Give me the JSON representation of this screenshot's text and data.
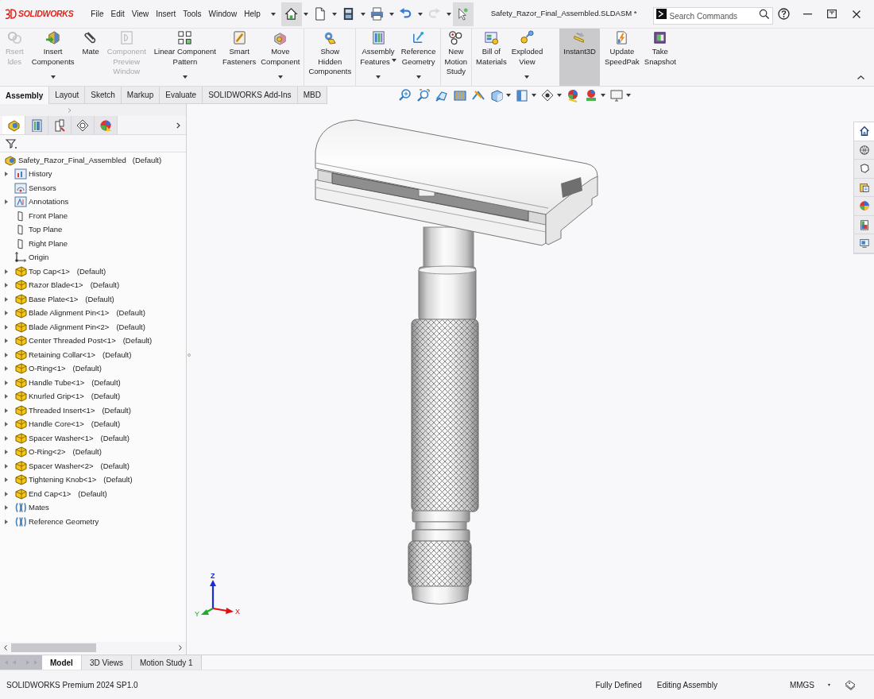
{
  "title_bar": {
    "logo": "SOLIDWORKS",
    "menu": [
      "File",
      "Edit",
      "View",
      "Insert",
      "Tools",
      "Window",
      "Help"
    ],
    "quick_access": [
      {
        "selected": true,
        "disabled": false,
        "dropdown": true
      },
      {
        "selected": false,
        "disabled": false,
        "dropdown": true
      },
      {
        "selected": false,
        "disabled": false,
        "dropdown": true
      },
      {
        "selected": false,
        "disabled": false,
        "dropdown": true
      },
      {
        "selected": false,
        "disabled": false,
        "dropdown": true
      },
      {
        "selected": false,
        "disabled": true,
        "dropdown": true
      },
      {
        "selected": true,
        "disabled": false,
        "dropdown": false
      }
    ],
    "document_title": "Safety_Razor_Final_Assembled.SLDASM *",
    "search": {
      "placeholder": "Search Commands"
    }
  },
  "ribbon": {
    "groups": [
      {
        "items": [
          {
            "lines": [
              "Rsert",
              "ldes"
            ],
            "disabled": true,
            "selected": false,
            "dropdown": false,
            "menu_caret": false
          },
          {
            "lines": [
              "Insert",
              "Components"
            ],
            "disabled": false,
            "selected": false,
            "dropdown": true,
            "menu_caret": false
          },
          {
            "lines": [
              "Mate"
            ],
            "disabled": false,
            "selected": false,
            "dropdown": false,
            "menu_caret": false
          },
          {
            "lines": [
              "Component",
              "Preview",
              "Window"
            ],
            "disabled": true,
            "selected": false,
            "dropdown": false,
            "menu_caret": false
          },
          {
            "lines": [
              "Linear Component",
              "Pattern"
            ],
            "disabled": false,
            "selected": false,
            "dropdown": true,
            "menu_caret": false
          },
          {
            "lines": [
              "Smart",
              "Fasteners"
            ],
            "disabled": false,
            "selected": false,
            "dropdown": false,
            "menu_caret": false
          },
          {
            "lines": [
              "Move",
              "Component"
            ],
            "disabled": false,
            "selected": false,
            "dropdown": true,
            "menu_caret": false
          }
        ]
      },
      {
        "items": [
          {
            "lines": [
              "Show",
              "Hidden",
              "Components"
            ],
            "disabled": false,
            "selected": false,
            "dropdown": false,
            "menu_caret": false
          }
        ]
      },
      {
        "items": [
          {
            "lines": [
              "Assembly",
              "Features"
            ],
            "disabled": false,
            "selected": false,
            "dropdown": true,
            "menu_caret": true
          },
          {
            "lines": [
              "Reference",
              "Geometry"
            ],
            "disabled": false,
            "selected": false,
            "dropdown": true,
            "menu_caret": false
          }
        ]
      },
      {
        "items": [
          {
            "lines": [
              "New",
              "Motion",
              "Study"
            ],
            "disabled": false,
            "selected": false,
            "dropdown": false,
            "menu_caret": false
          }
        ]
      },
      {
        "items": [
          {
            "lines": [
              "Bill of",
              "Materials"
            ],
            "disabled": false,
            "selected": false,
            "dropdown": false,
            "menu_caret": false
          },
          {
            "lines": [
              "Exploded",
              "View"
            ],
            "disabled": false,
            "selected": false,
            "dropdown": true,
            "menu_caret": false
          },
          {
            "lines": [
              "Instant3D"
            ],
            "disabled": false,
            "selected": true,
            "dropdown": false,
            "menu_caret": false
          },
          {
            "lines": [
              "Update",
              "SpeedPak"
            ],
            "disabled": false,
            "selected": false,
            "dropdown": false,
            "menu_caret": false
          },
          {
            "lines": [
              "Take",
              "Snapshot"
            ],
            "disabled": false,
            "selected": false,
            "dropdown": false,
            "menu_caret": false
          }
        ]
      }
    ]
  },
  "command_tabs": [
    {
      "label": "Assembly",
      "selected": true
    },
    {
      "label": "Layout",
      "selected": false
    },
    {
      "label": "Sketch",
      "selected": false
    },
    {
      "label": "Markup",
      "selected": false
    },
    {
      "label": "Evaluate",
      "selected": false
    },
    {
      "label": "SOLIDWORKS Add-Ins",
      "selected": false
    },
    {
      "label": "MBD",
      "selected": false
    }
  ],
  "view_toolbar": [
    {
      "dropdown": false
    },
    {
      "dropdown": false
    },
    {
      "dropdown": false
    },
    {
      "dropdown": false
    },
    {
      "dropdown": false
    },
    {
      "dropdown": true
    },
    {
      "dropdown": true
    },
    {
      "dropdown": true
    },
    {
      "dropdown": false
    },
    {
      "dropdown": true
    },
    {
      "dropdown": true
    }
  ],
  "feature_manager": {
    "panel_tabs": [
      {
        "selected": true
      },
      {
        "selected": false
      },
      {
        "selected": false
      },
      {
        "selected": false
      },
      {
        "selected": false
      }
    ],
    "tree": {
      "kind": "assembly",
      "name": "Safety_Razor_Final_Assembled",
      "config": "(Default)",
      "children": [
        {
          "kind": "history",
          "name": "History",
          "expandable": true
        },
        {
          "kind": "sensors",
          "name": "Sensors",
          "expandable": false
        },
        {
          "kind": "annotations",
          "name": "Annotations",
          "expandable": true
        },
        {
          "kind": "plane",
          "name": "Front Plane",
          "expandable": false
        },
        {
          "kind": "plane",
          "name": "Top Plane",
          "expandable": false
        },
        {
          "kind": "plane",
          "name": "Right Plane",
          "expandable": false
        },
        {
          "kind": "origin",
          "name": "Origin",
          "expandable": false
        },
        {
          "kind": "part",
          "name": "Top Cap<1>",
          "config": "(Default)",
          "expandable": true
        },
        {
          "kind": "part",
          "name": "Razor Blade<1>",
          "config": "(Default)",
          "expandable": true
        },
        {
          "kind": "part",
          "name": "Base Plate<1>",
          "config": "(Default)",
          "expandable": true
        },
        {
          "kind": "part",
          "name": "Blade Alignment Pin<1>",
          "config": "(Default)",
          "expandable": true
        },
        {
          "kind": "part",
          "name": "Blade Alignment Pin<2>",
          "config": "(Default)",
          "expandable": true
        },
        {
          "kind": "part",
          "name": "Center Threaded Post<1>",
          "config": "(Default)",
          "expandable": true
        },
        {
          "kind": "part",
          "name": "Retaining Collar<1>",
          "config": "(Default)",
          "expandable": true
        },
        {
          "kind": "part",
          "name": "O-Ring<1>",
          "config": "(Default)",
          "expandable": true
        },
        {
          "kind": "part",
          "name": "Handle Tube<1>",
          "config": "(Default)",
          "expandable": true
        },
        {
          "kind": "part",
          "name": "Knurled Grip<1>",
          "config": "(Default)",
          "expandable": true
        },
        {
          "kind": "part",
          "name": "Threaded Insert<1>",
          "config": "(Default)",
          "expandable": true
        },
        {
          "kind": "part",
          "name": "Handle Core<1>",
          "config": "(Default)",
          "expandable": true
        },
        {
          "kind": "part",
          "name": "Spacer Washer<1>",
          "config": "(Default)",
          "expandable": true
        },
        {
          "kind": "part",
          "name": "O-Ring<2>",
          "config": "(Default)",
          "expandable": true
        },
        {
          "kind": "part",
          "name": "Spacer Washer<2>",
          "config": "(Default)",
          "expandable": true
        },
        {
          "kind": "part",
          "name": "Tightening Knob<1>",
          "config": "(Default)",
          "expandable": true
        },
        {
          "kind": "part",
          "name": "End Cap<1>",
          "config": "(Default)",
          "expandable": true
        },
        {
          "kind": "mates",
          "name": "Mates",
          "expandable": true
        },
        {
          "kind": "refgeom",
          "name": "Reference Geometry",
          "expandable": true
        }
      ]
    }
  },
  "viewport": {
    "triad": {
      "x": "X",
      "y": "Y",
      "z": "Z"
    },
    "task_pane": [
      {
        "selected": true
      },
      {
        "selected": false
      },
      {
        "selected": false
      },
      {
        "selected": false
      },
      {
        "selected": false
      },
      {
        "selected": false
      },
      {
        "selected": false
      }
    ]
  },
  "bottom_tabs": [
    {
      "label": "Model",
      "selected": true
    },
    {
      "label": "3D Views",
      "selected": false
    },
    {
      "label": "Motion Study 1",
      "selected": false
    }
  ],
  "status_bar": {
    "product": "SOLIDWORKS Premium 2024 SP1.0",
    "state": "Fully Defined",
    "mode": "Editing Assembly",
    "units": "MMGS"
  }
}
